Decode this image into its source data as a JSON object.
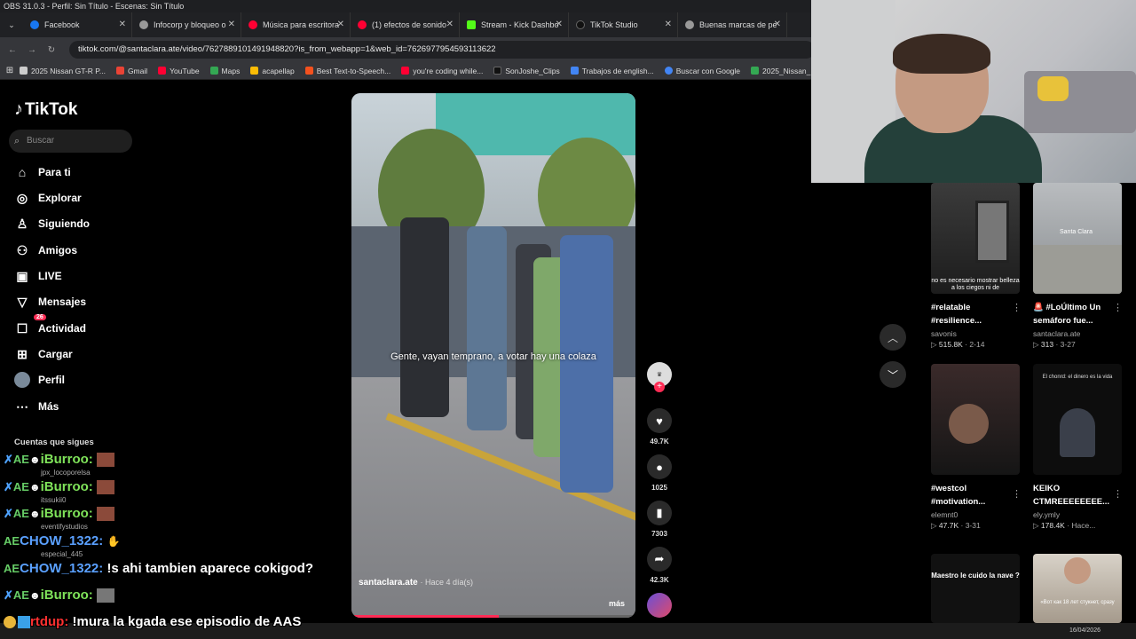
{
  "window": {
    "title": "OBS 31.0.3 - Perfil: Sin Título - Escenas: Sin Título"
  },
  "tabs": [
    {
      "label": "Facebook",
      "color": "#1877f2"
    },
    {
      "label": "Infocorp y bloqueo o",
      "color": "#999"
    },
    {
      "label": "Música para escritora",
      "color": "#ff0033"
    },
    {
      "label": "(1) efectos de sonido",
      "color": "#ff0033"
    },
    {
      "label": "Stream - Kick Dashbo",
      "color": "#53fc18"
    },
    {
      "label": "TikTok Studio",
      "color": "#111"
    },
    {
      "label": "Buenas marcas de pe",
      "color": "#999"
    }
  ],
  "address": {
    "url": "tiktok.com/@santaclara.ate/video/7627889101491948820?is_from_webapp=1&web_id=7626977954593113622"
  },
  "bookmarks": [
    {
      "label": "2025 Nissan GT-R P...",
      "color": "#ccc"
    },
    {
      "label": "Gmail",
      "color": "#ea4335"
    },
    {
      "label": "YouTube",
      "color": "#ff0033"
    },
    {
      "label": "Maps",
      "color": "#34a853"
    },
    {
      "label": "acapellap",
      "color": "#fbbc05"
    },
    {
      "label": "Best Text-to-Speech...",
      "color": "#f4511e"
    },
    {
      "label": "you're coding while...",
      "color": "#ff0033"
    },
    {
      "label": "SonJoshe_Clips",
      "color": "#111"
    },
    {
      "label": "Trabajos de english...",
      "color": "#4285f4"
    },
    {
      "label": "Buscar con Google",
      "color": "#4285f4"
    },
    {
      "label": "2025_Nissan_",
      "color": "#34a853"
    }
  ],
  "sidebar": {
    "logo": "TikTok",
    "search_placeholder": "Buscar",
    "items": [
      {
        "label": "Para ti",
        "icon": "home-icon"
      },
      {
        "label": "Explorar",
        "icon": "compass-icon"
      },
      {
        "label": "Siguiendo",
        "icon": "following-icon"
      },
      {
        "label": "Amigos",
        "icon": "friends-icon"
      },
      {
        "label": "LIVE",
        "icon": "live-icon"
      },
      {
        "label": "Mensajes",
        "icon": "messages-icon"
      },
      {
        "label": "Actividad",
        "icon": "activity-icon",
        "badge": "26"
      },
      {
        "label": "Cargar",
        "icon": "upload-icon"
      },
      {
        "label": "Perfil",
        "icon": "avatar"
      },
      {
        "label": "Más",
        "icon": "more-icon"
      }
    ],
    "following_header": "Cuentas que sigues",
    "accounts": [
      "jpx_locoporelsa",
      "itssukii0",
      "eventifystudios",
      "especial_445"
    ]
  },
  "video": {
    "caption": "Gente, vayan temprano, a votar hay una colaza",
    "author": "santaclara.ate",
    "time": "· Hace 4 día(s)",
    "more": "más",
    "progress": 0.52
  },
  "actions": {
    "likes": "49.7K",
    "comments": "1025",
    "saves": "7303",
    "shares": "42.3K"
  },
  "grid": [
    {
      "title": "#relatable #resilience...",
      "author": "savonis",
      "views": "515.8K",
      "date": "2-14",
      "overlay": "no es necesario mostrar belleza a los ciegos ni de"
    },
    {
      "title": "🚨 #LoÚltimo Un semáforo fue...",
      "author": "santaclara.ate",
      "views": "313",
      "date": "3-27",
      "overlay": "Santa Clara"
    },
    {
      "title": "#westcol #motivation...",
      "author": "elemnt0",
      "views": "47.7K",
      "date": "3-31",
      "overlay": "El chonrd: el dinero es la vida"
    },
    {
      "title": "KEIKO CTMREEEEEEEE...",
      "author": "ely.ymly",
      "views": "178.4K",
      "date": "Hace...",
      "overlay": ""
    },
    {
      "title": "",
      "author": "",
      "views": "",
      "date": "",
      "overlay": "Maestro le cuido la nave ?"
    },
    {
      "title": "",
      "author": "",
      "views": "",
      "date": "",
      "overlay": "«Вот как 18 лет стукнет, сразу"
    }
  ],
  "chat": [
    {
      "name": "iBurroo:",
      "msg": "",
      "style": "n1"
    },
    {
      "name": "iBurroo:",
      "msg": "",
      "style": "n1"
    },
    {
      "name": "iBurroo:",
      "msg": "",
      "style": "n1"
    },
    {
      "name": "CHOW_1322:",
      "msg": "",
      "style": "n2"
    },
    {
      "name": "CHOW_1322:",
      "msg": "!s ahi tambien aparece cokigod?",
      "style": "n2"
    },
    {
      "name": "iBurroo:",
      "msg": "",
      "style": "n1"
    },
    {
      "name": "rtdup:",
      "msg": "!mura la kgada ese episodio de AAS",
      "style": "n3"
    }
  ],
  "taskbar": {
    "date": "16/04/2026"
  }
}
